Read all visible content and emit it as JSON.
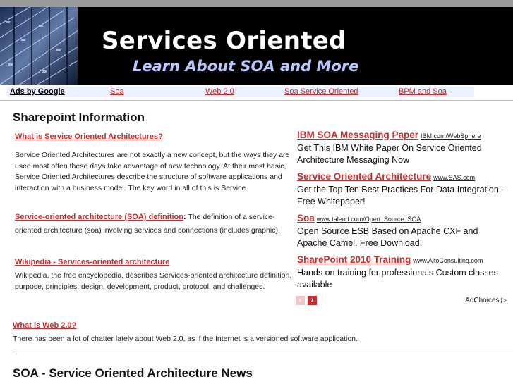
{
  "banner": {
    "title": "Services Oriented",
    "tagline": "Learn About SOA and More"
  },
  "link_bar": {
    "ads_label": "Ads by Google",
    "links": [
      "Soa",
      "Web 2.0",
      "Soa Service Oriented",
      "BPM and Soa"
    ]
  },
  "main": {
    "heading": "Sharepoint Information",
    "items": [
      {
        "title": "What is Service Oriented Architectures?",
        "text": "Service Oriented Architectures are not exactly a new concept, but the ways they are used most often these days take advantage of new technology. At their most basic, Service Oriented Architectures describe the structure of software applications and interaction with a business model. The key word in all of this is Service."
      },
      {
        "title": "Service-oriented architecture (SOA) definition",
        "title_suffix": ":",
        "text_inline": " The definition of a service-",
        "text": "oriented architecture (soa) involving services and connections (includes graphic)."
      },
      {
        "title": "Wikipedia - Services-oriented architecture ",
        "text": "Wikipedia, the free encyclopedia, describes Services-oriented architecture definition, purpose, principles, design, development, product, protocol, and challenges."
      },
      {
        "title": "What is Web 2.0? ",
        "text": "There has been a lot of chatter lately about Web 2.0, as if the Internet is a versioned software application."
      }
    ],
    "news_heading": "SOA - Service Oriented Architecture News"
  },
  "ads": {
    "items": [
      {
        "title": "IBM SOA Messaging Paper",
        "url": "IBM.com/WebSphere",
        "desc": "Get This IBM White Paper On Service Oriented Architecture Messaging Now"
      },
      {
        "title": "Service Oriented Architecture",
        "url": "www.SAS.com",
        "desc": "Get the Top Ten Best Practices For Data Integration – Free Whitepaper!"
      },
      {
        "title": "Soa",
        "url": "www.talend.com/Open_Source_SOA",
        "desc": "Open Source ESB Based on Apache CXF and Apache Camel. Free Download!"
      },
      {
        "title": "SharePoint 2010 Training",
        "url": "www.AltoConsulting.com",
        "desc": "Hands on training for professionals Custom classes available"
      }
    ],
    "adchoices_label": "AdChoices",
    "prev_glyph": "‹",
    "next_glyph": "›",
    "adchoices_glyph": "▷"
  },
  "colors": {
    "link_red": "#c03030",
    "banner_bg": "#000000",
    "tagline_blue": "#b8c8ff",
    "link_bar_bg": "#ecf1ff"
  }
}
